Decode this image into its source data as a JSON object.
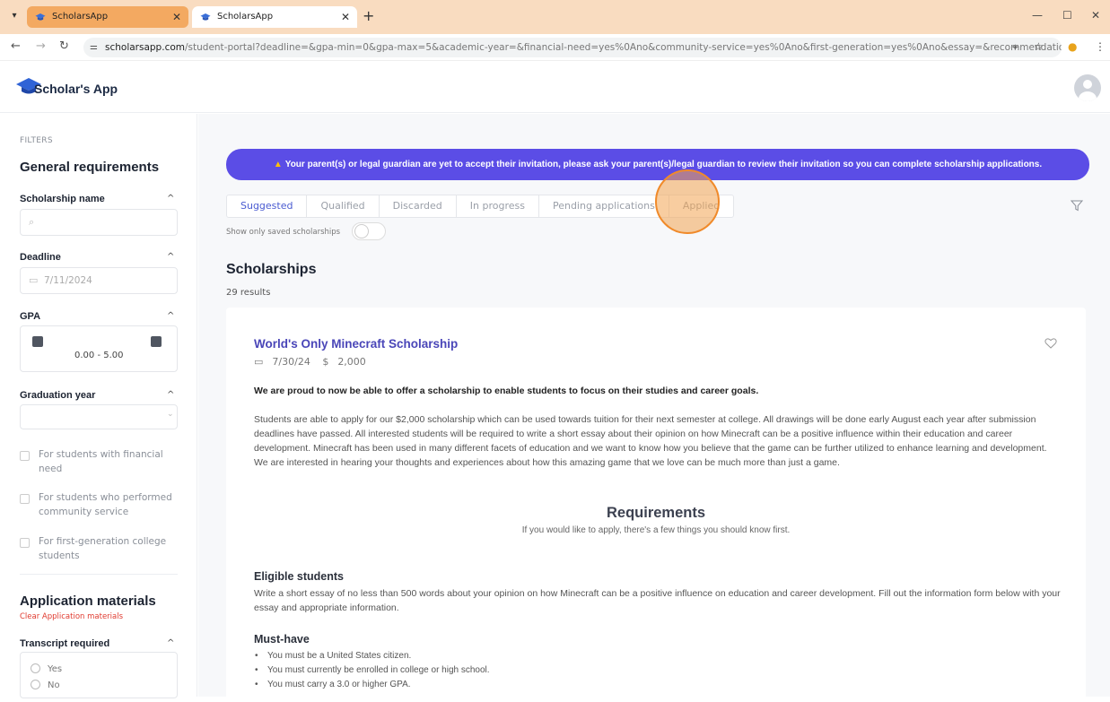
{
  "browser": {
    "tabs": [
      {
        "title": "ScholarsApp"
      },
      {
        "title": "ScholarsApp"
      }
    ],
    "url_host": "scholarsapp.com",
    "url_path": "/student-portal?deadline=&gpa-min=0&gpa-max=5&academic-year=&financial-need=yes%0Ano&community-service=yes%0Ano&first-generation=yes%0Ano&essay=&recommendation..."
  },
  "header": {
    "logo_text": "Scholar's App"
  },
  "sidebar": {
    "filters_label": "FILTERS",
    "general_title": "General requirements",
    "scholarship_name_label": "Scholarship name",
    "deadline_label": "Deadline",
    "deadline_value": "7/11/2024",
    "gpa_label": "GPA",
    "gpa_range": "0.00 - 5.00",
    "graduation_label": "Graduation year",
    "checkboxes": [
      "For students with financial need",
      "For students who performed community service",
      "For first-generation college students"
    ],
    "application_title": "Application materials",
    "clear_link": "Clear Application materials",
    "transcript_label": "Transcript required",
    "radio_yes": "Yes",
    "radio_no": "No"
  },
  "main": {
    "banner_text": "Your parent(s) or legal guardian are yet to accept their invitation, please ask your parent(s)/legal guardian to review their invitation so you can complete scholarship applications.",
    "tabs": [
      "Suggested",
      "Qualified",
      "Discarded",
      "In progress",
      "Pending applications",
      "Applied"
    ],
    "toggle_label": "Show only saved scholarships",
    "title": "Scholarships",
    "results": "29 results"
  },
  "card": {
    "title": "World's Only Minecraft Scholarship",
    "date": "7/30/24",
    "amount": "2,000",
    "lead": "We are proud to now be able to offer a scholarship to enable students to focus on their studies and career goals.",
    "body": "Students are able to apply for our $2,000 scholarship which can be used towards tuition for their next semester at college. All drawings will be done early August each year after submission deadlines have passed. All interested students will be required to write a short essay about their opinion on how Minecraft can be a positive influence within their education and career development. Minecraft has been used in many different facets of education and we want to know how you believe that the game can be further utilized to enhance learning and development. We are interested in hearing your thoughts and experiences about how this amazing game that we love can be much more than just a game.",
    "requirements_title": "Requirements",
    "requirements_sub": "If you would like to apply, there's a few things you should know first.",
    "eligible_title": "Eligible students",
    "eligible_body": "Write a short essay of no less than 500 words about your opinion on how Minecraft can be a positive influence on education and career development. Fill out the information form below with your essay and appropriate information.",
    "musthave_title": "Must-have",
    "musthave": [
      "You must be a United States citizen.",
      "You must currently be enrolled in college or high school.",
      "You must carry a 3.0 or higher GPA."
    ]
  }
}
